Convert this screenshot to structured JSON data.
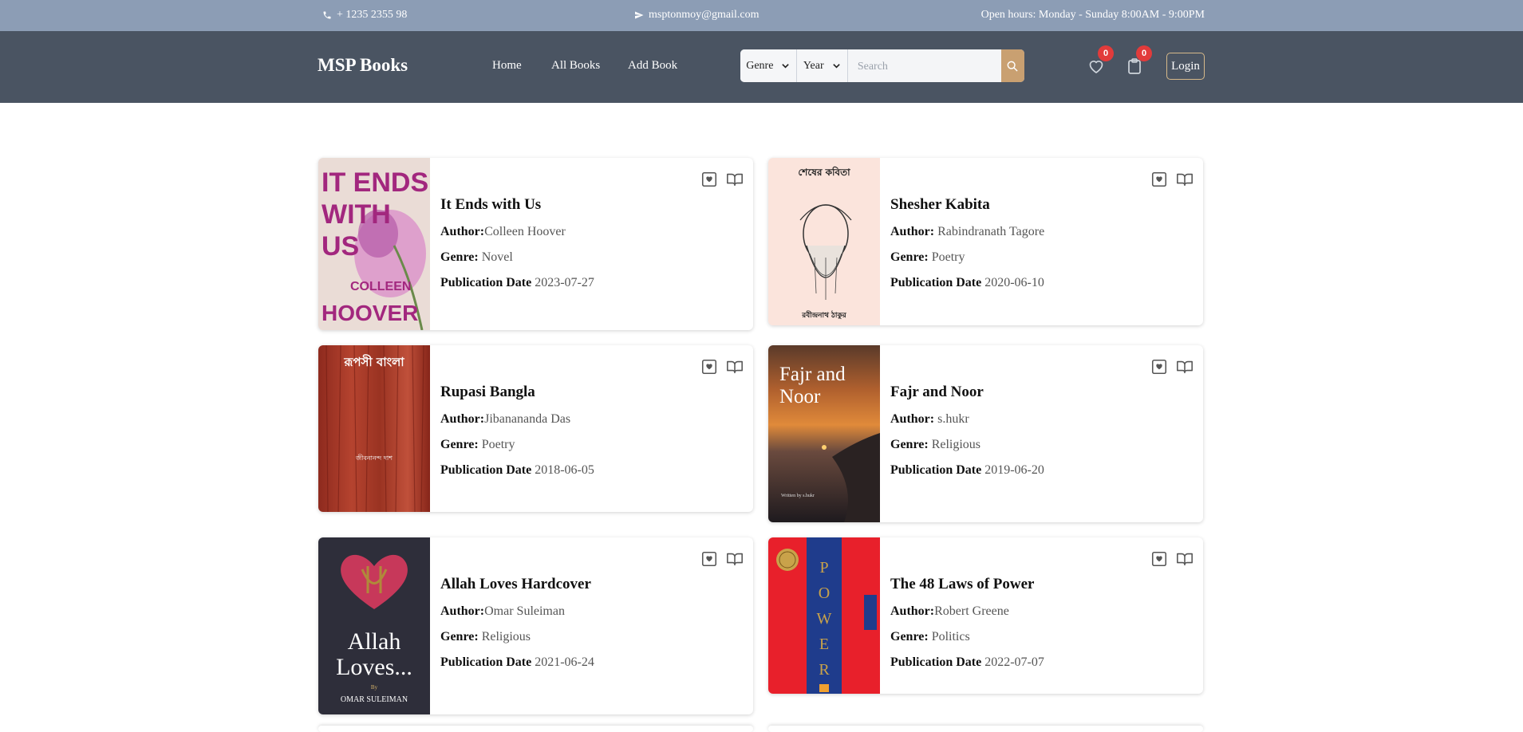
{
  "topbar": {
    "phone": "+ 1235 2355 98",
    "email": "msptonmoy@gmail.com",
    "hours": "Open hours: Monday - Sunday 8:00AM - 9:00PM"
  },
  "nav": {
    "brand": "MSP Books",
    "links": [
      "Home",
      "All Books",
      "Add Book"
    ],
    "genre_label": "Genre",
    "year_label": "Year",
    "search_placeholder": "Search",
    "wishlist_count": "0",
    "cart_count": "0",
    "login_label": "Login"
  },
  "labels": {
    "author": "Author:",
    "genre": "Genre:",
    "date": "Publication Date"
  },
  "books": [
    {
      "title": "It Ends with Us",
      "author": "Colleen Hoover",
      "genre": "Novel",
      "date": "2023-07-27",
      "cover_text": [
        "IT ENDS",
        "WITH",
        "US",
        "COLLEEN",
        "HOOVER"
      ]
    },
    {
      "title": "Shesher Kabita",
      "author": "Rabindranath Tagore",
      "genre": "Poetry",
      "date": "2020-06-10",
      "cover_text": [
        "শেষের কবিতা",
        "রবীন্দ্রনাথ ঠাকুর"
      ]
    },
    {
      "title": "Rupasi Bangla",
      "author": "Jibanananda Das",
      "genre": "Poetry",
      "date": "2018-06-05",
      "cover_text": [
        "রূপসী বাংলা",
        "জীবনানন্দ দাশ"
      ]
    },
    {
      "title": "Fajr and Noor",
      "author": "s.hukr",
      "genre": "Religious",
      "date": "2019-06-20",
      "cover_text": [
        "Fajr and",
        "Noor",
        "Written by s.hukr"
      ]
    },
    {
      "title": "Allah Loves Hardcover",
      "author": "Omar Suleiman",
      "genre": "Religious",
      "date": "2021-06-24",
      "cover_text": [
        "Allah",
        "Loves...",
        "By",
        "OMAR SULEIMAN"
      ]
    },
    {
      "title": "The 48 Laws of Power",
      "author": "Robert Greene",
      "genre": "Politics",
      "date": "2022-07-07",
      "cover_text": [
        "POWER"
      ]
    }
  ],
  "colors": {
    "topbar": "#8c9db5",
    "navbar": "#4a5462",
    "accent": "#c9a071",
    "badge": "#e23b3b"
  },
  "icons": {
    "phone": "phone-icon",
    "email": "paper-plane-icon",
    "search": "search-icon",
    "wishlist": "heart-icon",
    "cart": "clipboard-icon",
    "save": "bookmark-heart-icon",
    "read": "open-book-icon"
  }
}
